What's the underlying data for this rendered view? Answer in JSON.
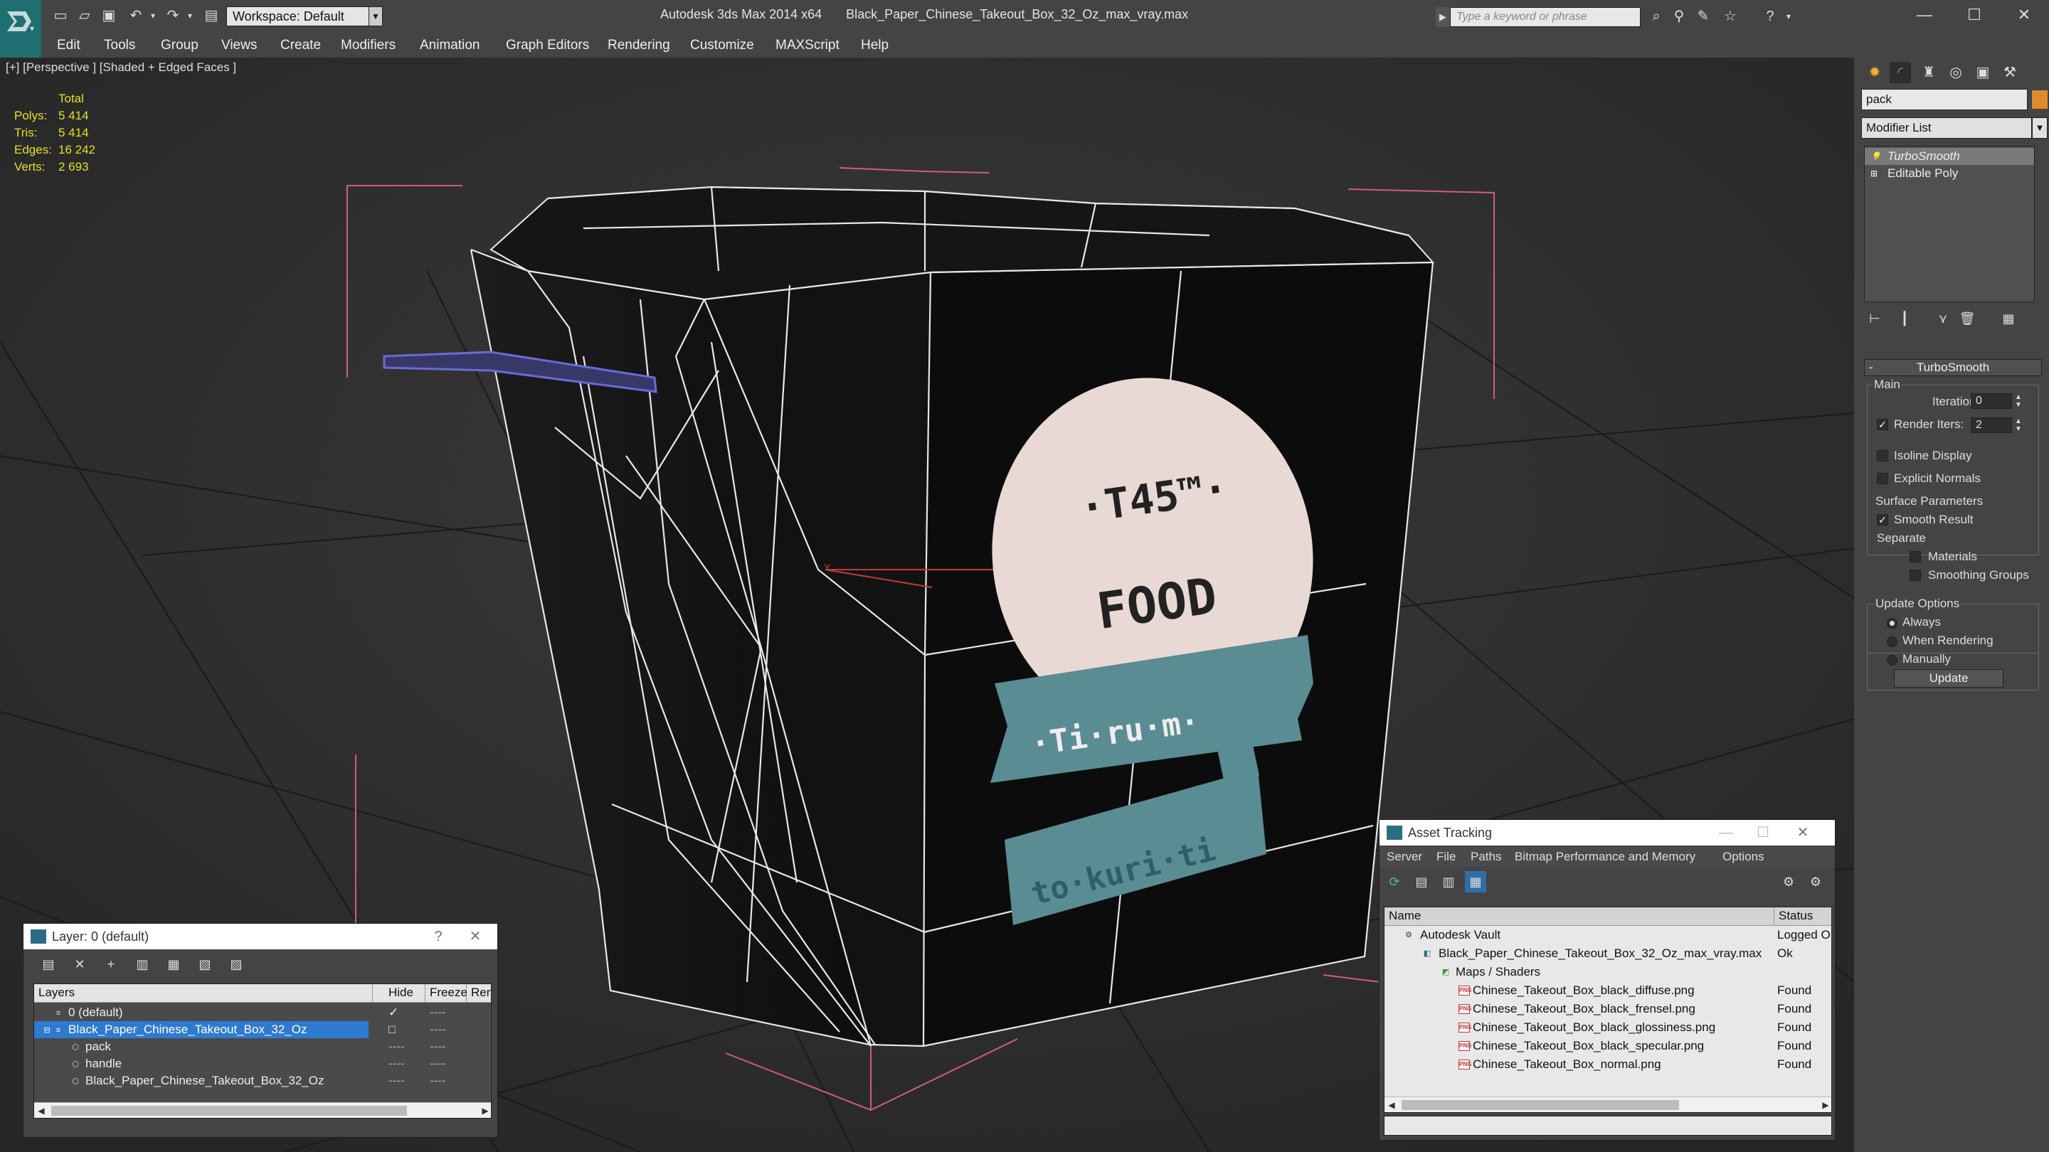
{
  "app": {
    "title_app": "Autodesk 3ds Max  2014 x64",
    "title_file": "Black_Paper_Chinese_Takeout_Box_32_Oz_max_vray.max",
    "workspace": "Workspace: Default",
    "search_placeholder": "Type a keyword or phrase",
    "accent": "#1f6f72"
  },
  "menu": [
    "Edit",
    "Tools",
    "Group",
    "Views",
    "Create",
    "Modifiers",
    "Animation",
    "Graph Editors",
    "Rendering",
    "Customize",
    "MAXScript",
    "Help"
  ],
  "viewport": {
    "label": "[+] [Perspective ] [Shaded + Edged Faces ]",
    "stats": {
      "header": "Total",
      "rows": [
        {
          "label": "Polys:",
          "value": "5 414"
        },
        {
          "label": "Tris:",
          "value": "5 414"
        },
        {
          "label": "Edges:",
          "value": "16 242"
        },
        {
          "label": "Verts:",
          "value": "2 693"
        }
      ]
    },
    "logo_texts": {
      "line1": "·T45™·",
      "line2": "FOOD",
      "ribbon": "·Ti·ru·m·",
      "tag": "to·kuri·ti"
    }
  },
  "command_panel": {
    "object_name": "pack",
    "modifier_list": "Modifier List",
    "stack": [
      "TurboSmooth",
      "Editable Poly"
    ],
    "rollout_title": "TurboSmooth",
    "main_group": "Main",
    "iterations_label": "Iterations:",
    "iterations_value": "0",
    "render_iters_label": "Render Iters:",
    "render_iters_value": "2",
    "isoline": "Isoline Display",
    "explicit": "Explicit Normals",
    "surface_group": "Surface Parameters",
    "smooth_result": "Smooth Result",
    "separate": "Separate",
    "materials": "Materials",
    "smoothing_groups": "Smoothing Groups",
    "update_group": "Update Options",
    "always": "Always",
    "when_rendering": "When Rendering",
    "manually": "Manually",
    "update_btn": "Update"
  },
  "layer_dialog": {
    "title": "Layer: 0 (default)",
    "help": "?",
    "close": "✕",
    "columns": [
      "Layers",
      "Hide",
      "Freeze",
      "Ren"
    ],
    "rows": [
      {
        "name": "0 (default)",
        "hide": "✓",
        "freeze": "----",
        "render": "",
        "indent": 1
      },
      {
        "name": "Black_Paper_Chinese_Takeout_Box_32_Oz",
        "hide": "□",
        "freeze": "----",
        "render": "",
        "indent": 1,
        "selected": true
      },
      {
        "name": "pack",
        "hide": "----",
        "freeze": "----",
        "render": "",
        "indent": 2
      },
      {
        "name": "handle",
        "hide": "----",
        "freeze": "----",
        "render": "",
        "indent": 2
      },
      {
        "name": "Black_Paper_Chinese_Takeout_Box_32_Oz",
        "hide": "----",
        "freeze": "----",
        "render": "",
        "indent": 2
      }
    ]
  },
  "asset_dialog": {
    "title": "Asset Tracking",
    "menu": [
      "Server",
      "File",
      "Paths",
      "Bitmap Performance and Memory",
      "Options"
    ],
    "columns": [
      "Name",
      "Status"
    ],
    "rows": [
      {
        "name": "Autodesk Vault",
        "status": "Logged O",
        "indent": 1
      },
      {
        "name": "Black_Paper_Chinese_Takeout_Box_32_Oz_max_vray.max",
        "status": "Ok",
        "indent": 2
      },
      {
        "name": "Maps / Shaders",
        "status": "",
        "indent": 3
      },
      {
        "name": "Chinese_Takeout_Box_black_diffuse.png",
        "status": "Found",
        "indent": 4
      },
      {
        "name": "Chinese_Takeout_Box_black_frensel.png",
        "status": "Found",
        "indent": 4
      },
      {
        "name": "Chinese_Takeout_Box_black_glossiness.png",
        "status": "Found",
        "indent": 4
      },
      {
        "name": "Chinese_Takeout_Box_black_specular.png",
        "status": "Found",
        "indent": 4
      },
      {
        "name": "Chinese_Takeout_Box_normal.png",
        "status": "Found",
        "indent": 4
      }
    ]
  }
}
